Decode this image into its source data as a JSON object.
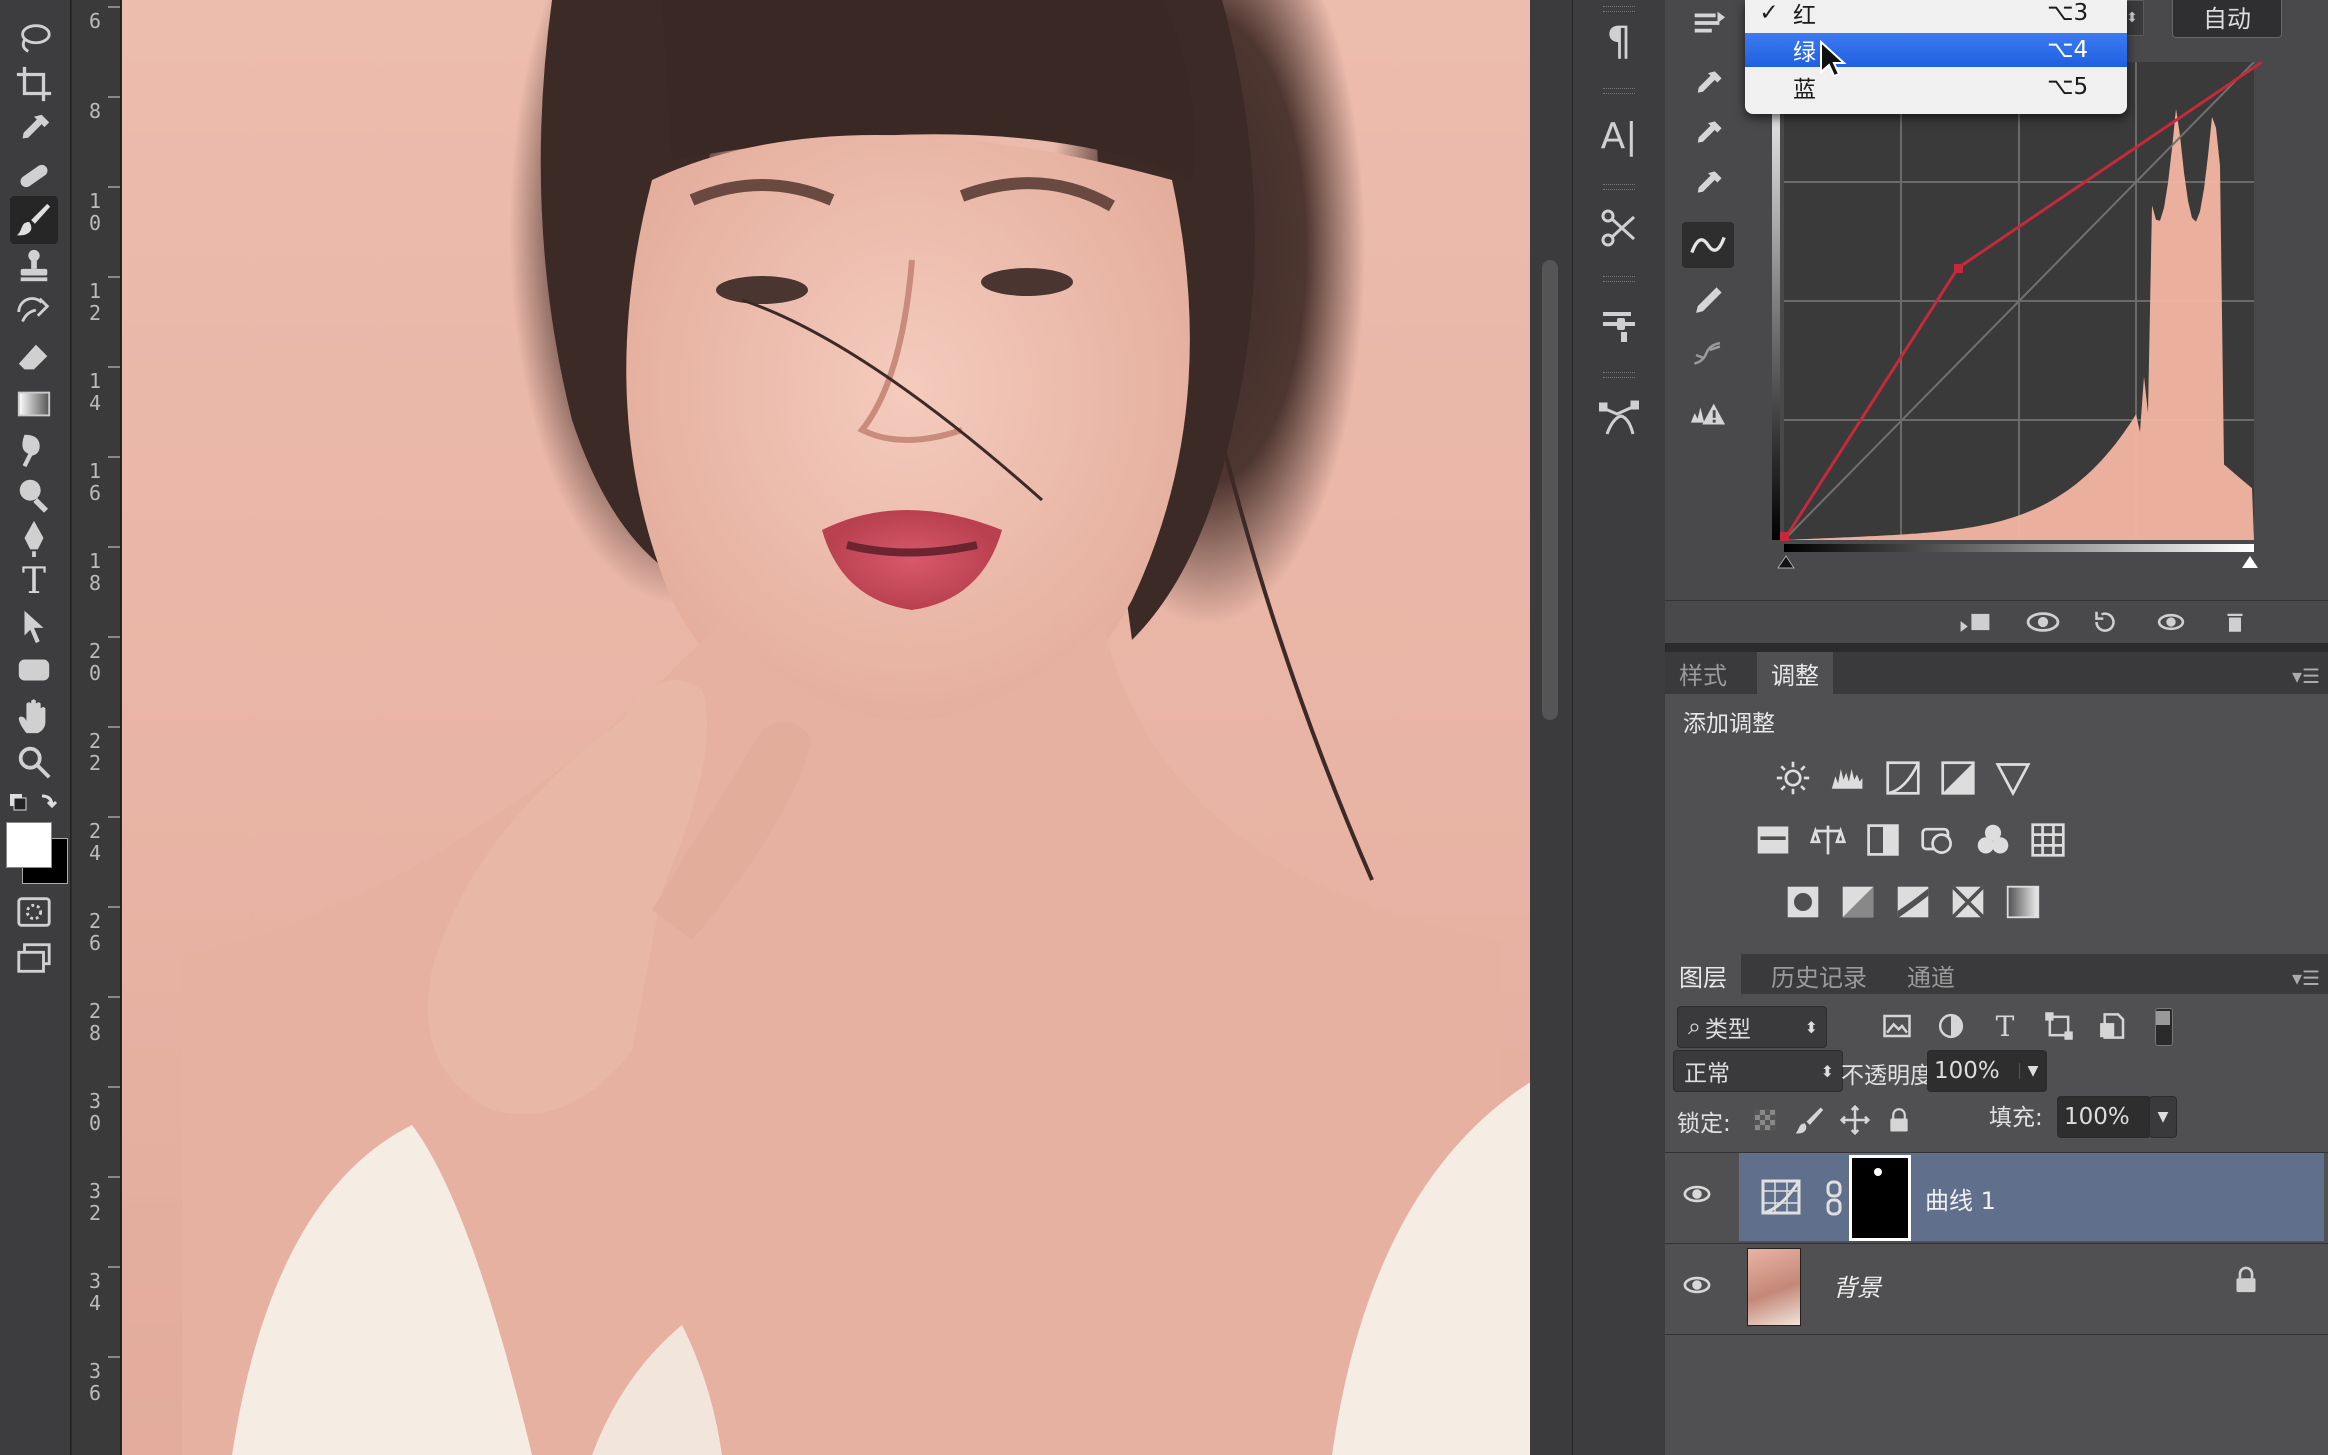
{
  "toolbar": {
    "tools": [
      "lasso-icon",
      "crop-icon",
      "eyedropper-icon",
      "healing-brush-icon",
      "brush-icon",
      "clone-stamp-icon",
      "history-brush-icon",
      "eraser-icon",
      "gradient-icon",
      "smudge-icon",
      "dodge-icon",
      "pen-icon",
      "type-icon",
      "path-selection-icon",
      "rectangle-icon",
      "hand-icon",
      "zoom-icon"
    ],
    "type_glyph": "T"
  },
  "ruler": {
    "labels": [
      "6",
      "8",
      "10",
      "12",
      "14",
      "16",
      "18",
      "20",
      "22",
      "24",
      "26",
      "28",
      "30",
      "32",
      "34",
      "36"
    ]
  },
  "channel_dropdown": {
    "items": [
      {
        "check": "✓",
        "label": "红",
        "shortcut": "⌥3",
        "highlighted": false
      },
      {
        "check": "",
        "label": "绿",
        "shortcut": "⌥4",
        "highlighted": true
      },
      {
        "check": "",
        "label": "蓝",
        "shortcut": "⌥5",
        "highlighted": false
      }
    ]
  },
  "curves": {
    "auto_button": "自动",
    "curve_color": "#c42a3a",
    "histogram_fill": "#f4b6a2"
  },
  "adjustments_tabs": {
    "tabs": [
      "样式",
      "调整"
    ],
    "active": "调整"
  },
  "adjustments": {
    "title": "添加调整"
  },
  "layers_tabs": {
    "tabs": [
      "图层",
      "历史记录",
      "通道"
    ],
    "active": "图层"
  },
  "layers": {
    "filter_kind": "类型",
    "blend_mode": "正常",
    "opacity_label": "不透明度:",
    "opacity_value": "100%",
    "lock_label": "锁定:",
    "fill_label": "填充:",
    "fill_value": "100%",
    "items": [
      {
        "name": "曲线 1",
        "selected": true
      },
      {
        "name": "背景",
        "selected": false
      }
    ]
  },
  "colors": {
    "accent": "#1f5fe0",
    "selected_layer": "#60708c"
  }
}
